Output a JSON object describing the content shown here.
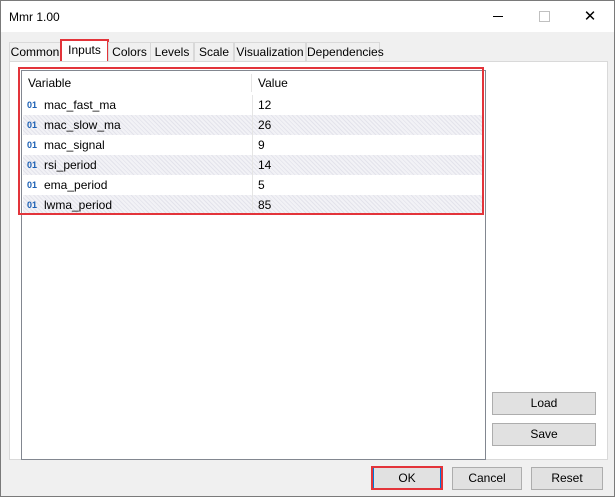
{
  "window": {
    "title": "Mmr 1.00",
    "controls": {
      "minimize_icon": "minimize-icon",
      "maximize_icon": "maximize-icon",
      "close_glyph": "✕"
    }
  },
  "tabs": [
    {
      "label": "Common",
      "active": false
    },
    {
      "label": "Inputs",
      "active": true
    },
    {
      "label": "Colors",
      "active": false
    },
    {
      "label": "Levels",
      "active": false
    },
    {
      "label": "Scale",
      "active": false
    },
    {
      "label": "Visualization",
      "active": false
    },
    {
      "label": "Dependencies",
      "active": false
    }
  ],
  "inputs_table": {
    "columns": [
      "Variable",
      "Value"
    ],
    "type_icon": "01",
    "rows": [
      {
        "variable": "mac_fast_ma",
        "value": "12"
      },
      {
        "variable": "mac_slow_ma",
        "value": "26"
      },
      {
        "variable": "mac_signal",
        "value": "9"
      },
      {
        "variable": "rsi_period",
        "value": "14"
      },
      {
        "variable": "ema_period",
        "value": "5"
      },
      {
        "variable": "lwma_period",
        "value": "85"
      }
    ]
  },
  "side_buttons": {
    "load": "Load",
    "save": "Save"
  },
  "footer_buttons": {
    "ok": "OK",
    "cancel": "Cancel",
    "reset": "Reset"
  },
  "colors": {
    "highlight": "#e3343a",
    "accent": "#0078d7",
    "type_icon": "#1a5fb4"
  }
}
